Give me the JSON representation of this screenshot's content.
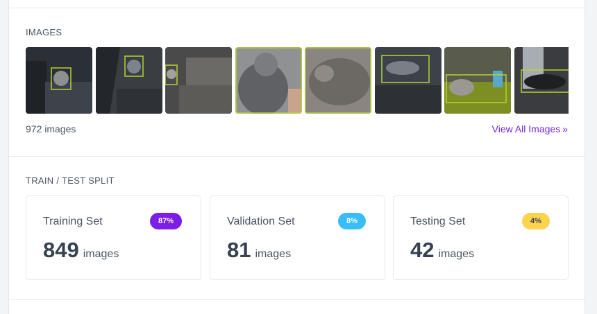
{
  "images_section": {
    "title": "IMAGES",
    "count_text": "972 images",
    "view_all_label": "View All Images",
    "view_all_icon": "double-chevron-right-icon",
    "thumbnails": [
      {
        "bg": "#2b2f36",
        "accent": "#6b7280"
      },
      {
        "bg": "#3a3d42",
        "accent": "#7d838c"
      },
      {
        "bg": "#4b4a4a",
        "accent": "#9a9791"
      },
      {
        "bg": "#8f9193",
        "accent": "#c6c4bf"
      },
      {
        "bg": "#8a8580",
        "accent": "#c9c2b8"
      },
      {
        "bg": "#3d4248",
        "accent": "#8a8f95"
      },
      {
        "bg": "#595b4b",
        "accent": "#8fb32a"
      },
      {
        "bg": "#3a3c40",
        "accent": "#9aa0a6"
      }
    ]
  },
  "split_section": {
    "title": "TRAIN / TEST SPLIT",
    "cards": [
      {
        "label": "Training Set",
        "badge": "87%",
        "count": "849",
        "unit": "images",
        "badge_bg": "#7c1ee8",
        "badge_fg": "#ffffff"
      },
      {
        "label": "Validation Set",
        "badge": "8%",
        "count": "81",
        "unit": "images",
        "badge_bg": "#38bdf8",
        "badge_fg": "#ffffff"
      },
      {
        "label": "Testing Set",
        "badge": "4%",
        "count": "42",
        "unit": "images",
        "badge_bg": "#fcd34d",
        "badge_fg": "#374151"
      }
    ]
  }
}
